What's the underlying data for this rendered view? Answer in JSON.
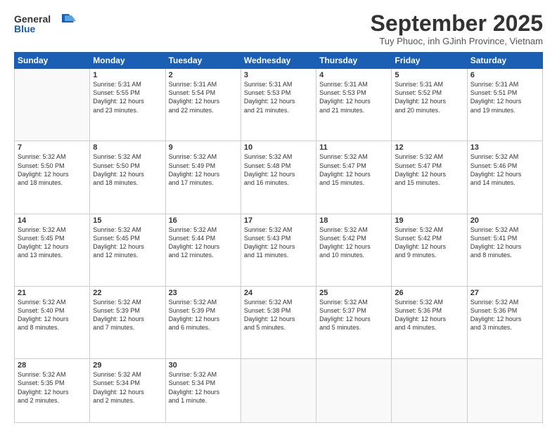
{
  "header": {
    "logo_general": "General",
    "logo_blue": "Blue",
    "month_title": "September 2025",
    "location": "Tuy Phuoc, inh GJinh Province, Vietnam"
  },
  "weekdays": [
    "Sunday",
    "Monday",
    "Tuesday",
    "Wednesday",
    "Thursday",
    "Friday",
    "Saturday"
  ],
  "weeks": [
    [
      {
        "day": "",
        "text": ""
      },
      {
        "day": "1",
        "text": "Sunrise: 5:31 AM\nSunset: 5:55 PM\nDaylight: 12 hours\nand 23 minutes."
      },
      {
        "day": "2",
        "text": "Sunrise: 5:31 AM\nSunset: 5:54 PM\nDaylight: 12 hours\nand 22 minutes."
      },
      {
        "day": "3",
        "text": "Sunrise: 5:31 AM\nSunset: 5:53 PM\nDaylight: 12 hours\nand 21 minutes."
      },
      {
        "day": "4",
        "text": "Sunrise: 5:31 AM\nSunset: 5:53 PM\nDaylight: 12 hours\nand 21 minutes."
      },
      {
        "day": "5",
        "text": "Sunrise: 5:31 AM\nSunset: 5:52 PM\nDaylight: 12 hours\nand 20 minutes."
      },
      {
        "day": "6",
        "text": "Sunrise: 5:31 AM\nSunset: 5:51 PM\nDaylight: 12 hours\nand 19 minutes."
      }
    ],
    [
      {
        "day": "7",
        "text": "Sunrise: 5:32 AM\nSunset: 5:50 PM\nDaylight: 12 hours\nand 18 minutes."
      },
      {
        "day": "8",
        "text": "Sunrise: 5:32 AM\nSunset: 5:50 PM\nDaylight: 12 hours\nand 18 minutes."
      },
      {
        "day": "9",
        "text": "Sunrise: 5:32 AM\nSunset: 5:49 PM\nDaylight: 12 hours\nand 17 minutes."
      },
      {
        "day": "10",
        "text": "Sunrise: 5:32 AM\nSunset: 5:48 PM\nDaylight: 12 hours\nand 16 minutes."
      },
      {
        "day": "11",
        "text": "Sunrise: 5:32 AM\nSunset: 5:47 PM\nDaylight: 12 hours\nand 15 minutes."
      },
      {
        "day": "12",
        "text": "Sunrise: 5:32 AM\nSunset: 5:47 PM\nDaylight: 12 hours\nand 15 minutes."
      },
      {
        "day": "13",
        "text": "Sunrise: 5:32 AM\nSunset: 5:46 PM\nDaylight: 12 hours\nand 14 minutes."
      }
    ],
    [
      {
        "day": "14",
        "text": "Sunrise: 5:32 AM\nSunset: 5:45 PM\nDaylight: 12 hours\nand 13 minutes."
      },
      {
        "day": "15",
        "text": "Sunrise: 5:32 AM\nSunset: 5:45 PM\nDaylight: 12 hours\nand 12 minutes."
      },
      {
        "day": "16",
        "text": "Sunrise: 5:32 AM\nSunset: 5:44 PM\nDaylight: 12 hours\nand 12 minutes."
      },
      {
        "day": "17",
        "text": "Sunrise: 5:32 AM\nSunset: 5:43 PM\nDaylight: 12 hours\nand 11 minutes."
      },
      {
        "day": "18",
        "text": "Sunrise: 5:32 AM\nSunset: 5:42 PM\nDaylight: 12 hours\nand 10 minutes."
      },
      {
        "day": "19",
        "text": "Sunrise: 5:32 AM\nSunset: 5:42 PM\nDaylight: 12 hours\nand 9 minutes."
      },
      {
        "day": "20",
        "text": "Sunrise: 5:32 AM\nSunset: 5:41 PM\nDaylight: 12 hours\nand 8 minutes."
      }
    ],
    [
      {
        "day": "21",
        "text": "Sunrise: 5:32 AM\nSunset: 5:40 PM\nDaylight: 12 hours\nand 8 minutes."
      },
      {
        "day": "22",
        "text": "Sunrise: 5:32 AM\nSunset: 5:39 PM\nDaylight: 12 hours\nand 7 minutes."
      },
      {
        "day": "23",
        "text": "Sunrise: 5:32 AM\nSunset: 5:39 PM\nDaylight: 12 hours\nand 6 minutes."
      },
      {
        "day": "24",
        "text": "Sunrise: 5:32 AM\nSunset: 5:38 PM\nDaylight: 12 hours\nand 5 minutes."
      },
      {
        "day": "25",
        "text": "Sunrise: 5:32 AM\nSunset: 5:37 PM\nDaylight: 12 hours\nand 5 minutes."
      },
      {
        "day": "26",
        "text": "Sunrise: 5:32 AM\nSunset: 5:36 PM\nDaylight: 12 hours\nand 4 minutes."
      },
      {
        "day": "27",
        "text": "Sunrise: 5:32 AM\nSunset: 5:36 PM\nDaylight: 12 hours\nand 3 minutes."
      }
    ],
    [
      {
        "day": "28",
        "text": "Sunrise: 5:32 AM\nSunset: 5:35 PM\nDaylight: 12 hours\nand 2 minutes."
      },
      {
        "day": "29",
        "text": "Sunrise: 5:32 AM\nSunset: 5:34 PM\nDaylight: 12 hours\nand 2 minutes."
      },
      {
        "day": "30",
        "text": "Sunrise: 5:32 AM\nSunset: 5:34 PM\nDaylight: 12 hours\nand 1 minute."
      },
      {
        "day": "",
        "text": ""
      },
      {
        "day": "",
        "text": ""
      },
      {
        "day": "",
        "text": ""
      },
      {
        "day": "",
        "text": ""
      }
    ]
  ]
}
